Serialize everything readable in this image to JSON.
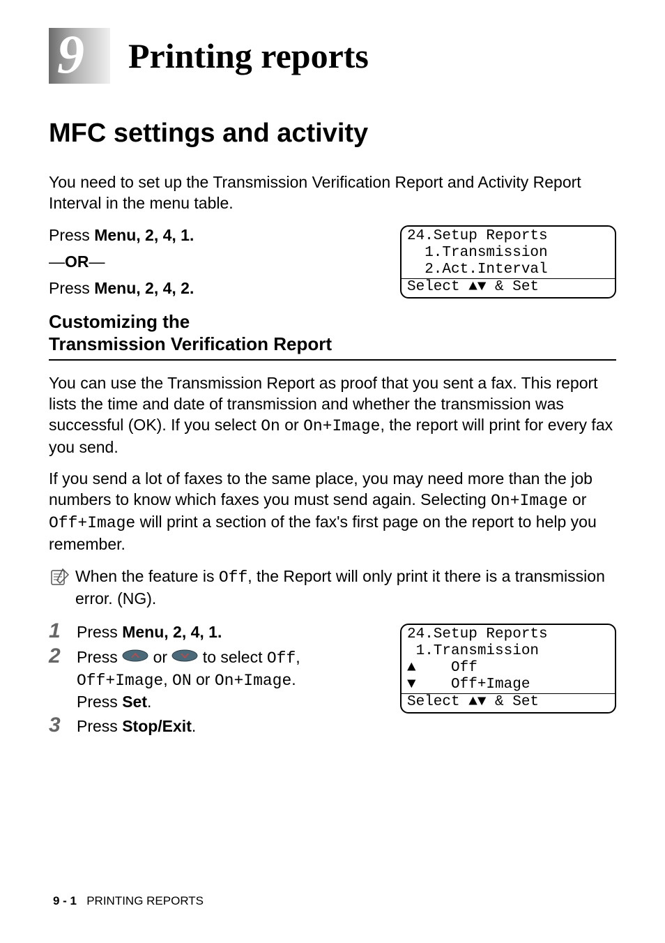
{
  "chapter": {
    "number": "9",
    "title": "Printing reports"
  },
  "section": {
    "title": "MFC settings and activity",
    "intro": "You need to set up the Transmission Verification Report and Activity Report Interval in the menu table.",
    "press1_pre": "Press ",
    "press1_bold": "Menu",
    "press1_seq": ", 2, 4, 1.",
    "or_pre": "—",
    "or_bold": "OR",
    "or_post": "—",
    "press2_pre": "Press ",
    "press2_bold": "Menu",
    "press2_seq": ", 2, 4, 2."
  },
  "lcd1": {
    "line1": "24.Setup Reports",
    "line2": "",
    "line3": "  1.Transmission",
    "line4": "  2.Act.Interval",
    "line5": "Select ▲▼ & Set"
  },
  "subsection": {
    "title_line1": "Customizing the",
    "title_line2": "Transmission Verification Report",
    "para1_a": "You can use the Transmission Report as proof that you sent a fax. This report lists the time and date of transmission and whether the transmission was successful (OK). If you select ",
    "para1_m1": "On",
    "para1_b": " or ",
    "para1_m2": "On+Image",
    "para1_c": ", the report will print for every fax you send.",
    "para2_a": "If you send a lot of faxes to the same place, you may need more than the job numbers to know which faxes you must send again. Selecting ",
    "para2_m1": "On+Image",
    "para2_b": " or ",
    "para2_m2": "Off+Image",
    "para2_c": " will print a section of the fax's first page on the report to help you remember.",
    "note_a": "When the feature is ",
    "note_m": "Off",
    "note_b": ", the Report will only print it there is a transmission error. (NG)."
  },
  "steps": {
    "s1_pre": "Press ",
    "s1_bold": "Menu",
    "s1_seq": ", 2, 4, 1.",
    "s2_a": "Press ",
    "s2_b": " or ",
    "s2_c": " to select ",
    "s2_m1": "Off",
    "s2_d": ", ",
    "s2_m2": "Off+Image",
    "s2_e": ", ",
    "s2_m3": "ON",
    "s2_f": " or ",
    "s2_m4": "On+Image",
    "s2_g": ".",
    "s2_press": "Press ",
    "s2_set": "Set",
    "s2_dot": ".",
    "s3_pre": "Press ",
    "s3_bold": "Stop/Exit",
    "s3_dot": "."
  },
  "lcd2": {
    "line1": "24.Setup Reports",
    "line2": " 1.Transmission",
    "line3": "▲    Off",
    "line4": "▼    Off+Image",
    "line5": "Select ▲▼ & Set"
  },
  "footer": {
    "page": "9 - 1",
    "label": "PRINTING REPORTS"
  }
}
